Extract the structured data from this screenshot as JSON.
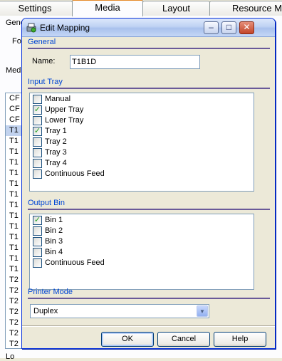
{
  "parent": {
    "tabs": [
      {
        "label": "Settings"
      },
      {
        "label": "Media"
      },
      {
        "label": "Layout"
      },
      {
        "label": "Resource M"
      }
    ],
    "general_label": "Gene",
    "format_label": "Fo",
    "media_label": "Med",
    "media_list": [
      "CF",
      "CF",
      "CF",
      "T1",
      "T1",
      "T1",
      "T1",
      "T1",
      "T1",
      "T1",
      "T1",
      "T1",
      "T1",
      "T1",
      "T1",
      "T1",
      "T1",
      "T2",
      "T2",
      "T2",
      "T2",
      "T2",
      "T2",
      "T2"
    ],
    "footer_fragment": "Lo"
  },
  "dialog": {
    "title": "Edit Mapping",
    "general": {
      "header": "General",
      "name_label": "Name:",
      "name_value": "T1B1D"
    },
    "input_tray": {
      "header": "Input Tray",
      "items": [
        {
          "label": "Manual",
          "checked": false
        },
        {
          "label": "Upper Tray",
          "checked": true
        },
        {
          "label": "Lower Tray",
          "checked": false
        },
        {
          "label": "Tray 1",
          "checked": true
        },
        {
          "label": "Tray 2",
          "checked": false
        },
        {
          "label": "Tray 3",
          "checked": false
        },
        {
          "label": "Tray 4",
          "checked": false
        },
        {
          "label": "Continuous Feed",
          "checked": false
        }
      ]
    },
    "output_bin": {
      "header": "Output Bin",
      "items": [
        {
          "label": "Bin 1",
          "checked": true
        },
        {
          "label": "Bin 2",
          "checked": false
        },
        {
          "label": "Bin 3",
          "checked": false
        },
        {
          "label": "Bin 4",
          "checked": false
        },
        {
          "label": "Continuous Feed",
          "checked": false
        }
      ]
    },
    "printer_mode": {
      "header": "Printer Mode",
      "selected": "Duplex"
    },
    "buttons": {
      "ok": "OK",
      "cancel": "Cancel",
      "help": "Help"
    },
    "title_buttons": {
      "minimize": "–",
      "maximize": "□",
      "close": "✕"
    }
  },
  "colors": {
    "accent": "#0046d5",
    "titlebar": "#bfd2f3",
    "check": "#21a121"
  }
}
